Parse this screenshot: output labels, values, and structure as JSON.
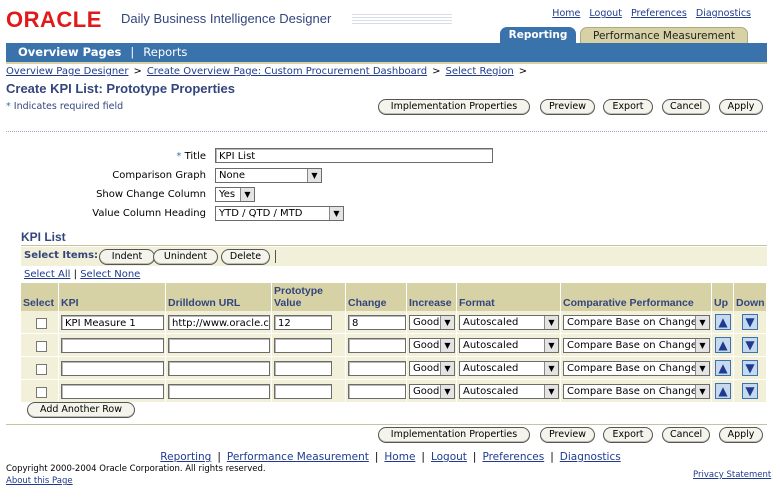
{
  "header": {
    "logo": "ORACLE",
    "product": "Daily Business Intelligence Designer",
    "global_links": [
      "Home",
      "Logout",
      "Preferences",
      "Diagnostics"
    ]
  },
  "tabs": {
    "active": "Reporting",
    "other": "Performance Measurement"
  },
  "subnav": {
    "active": "Overview Pages",
    "separator": "|",
    "other": "Reports"
  },
  "breadcrumbs": [
    "Overview Page Designer",
    "Create Overview Page: Custom Procurement Dashboard",
    "Select Region"
  ],
  "breadcrumb_sep": ">",
  "page_title": "Create KPI List: Prototype Properties",
  "required_note": "Indicates required field",
  "required_star": "*",
  "buttons": {
    "implementation": "Implementation Properties",
    "preview": "Preview",
    "export": "Export",
    "cancel": "Cancel",
    "apply": "Apply"
  },
  "form": {
    "title_label": "Title",
    "title_value": "KPI List",
    "comparison_label": "Comparison Graph",
    "comparison_value": "None",
    "show_change_label": "Show Change Column",
    "show_change_value": "Yes",
    "value_heading_label": "Value Column Heading",
    "value_heading_value": "YTD / QTD / MTD"
  },
  "kpi_section": {
    "title": "KPI List",
    "select_items_label": "Select Items:",
    "indent": "Indent",
    "unindent": "Unindent",
    "delete": "Delete",
    "select_all": "Select All",
    "select_none": "Select None",
    "select_sep": "|",
    "add_row": "Add Another Row"
  },
  "table": {
    "headers": {
      "select": "Select",
      "kpi": "KPI",
      "drilldown": "Drilldown URL",
      "prototype_1": "Prototype",
      "prototype_2": "Value",
      "change": "Change",
      "increase": "Increase",
      "format": "Format",
      "comparative": "Comparative Performance",
      "up": "Up",
      "down": "Down"
    },
    "rows": [
      {
        "kpi": "KPI Measure 1",
        "drilldown": "http://www.oracle.com",
        "prototype": "12",
        "change": "8",
        "increase": "Good",
        "format": "Autoscaled",
        "comparative": "Compare Base on Change"
      },
      {
        "kpi": "",
        "drilldown": "",
        "prototype": "",
        "change": "",
        "increase": "Good",
        "format": "Autoscaled",
        "comparative": "Compare Base on Change"
      },
      {
        "kpi": "",
        "drilldown": "",
        "prototype": "",
        "change": "",
        "increase": "Good",
        "format": "Autoscaled",
        "comparative": "Compare Base on Change"
      },
      {
        "kpi": "",
        "drilldown": "",
        "prototype": "",
        "change": "",
        "increase": "Good",
        "format": "Autoscaled",
        "comparative": "Compare Base on Change"
      }
    ]
  },
  "footer": {
    "links": [
      "Reporting",
      "Performance Measurement",
      "Home",
      "Logout",
      "Preferences",
      "Diagnostics"
    ],
    "link_sep": "|",
    "copyright": "Copyright 2000-2004 Oracle Corporation. All rights reserved.",
    "about": "About this Page",
    "privacy": "Privacy Statement"
  },
  "colors": {
    "accent_blue": "#3a72ab",
    "tan": "#d6d2a6",
    "oracle_red": "#e0191b",
    "heading_blue": "#33457d"
  }
}
